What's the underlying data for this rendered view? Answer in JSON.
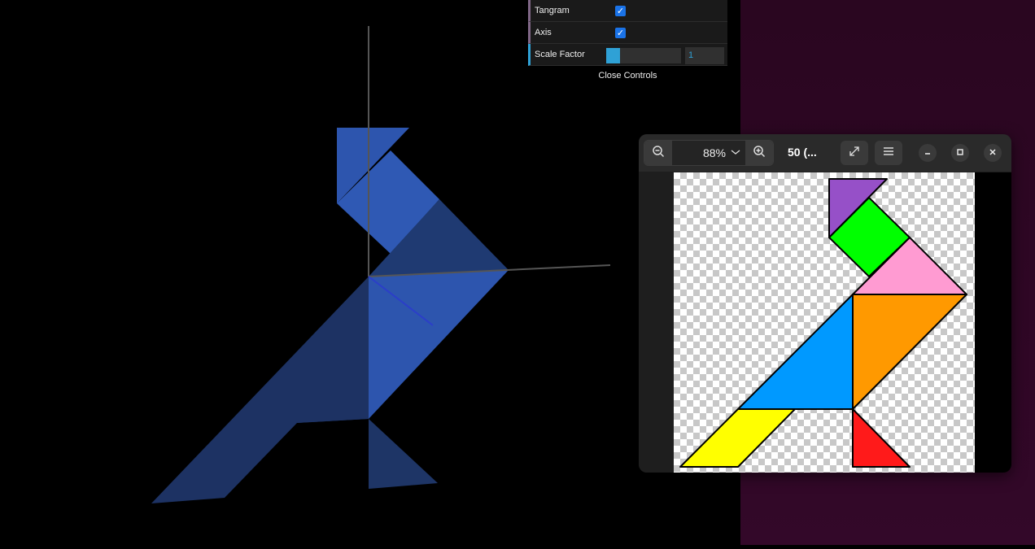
{
  "gui": {
    "rows": [
      {
        "label": "Tangram",
        "type": "boolean",
        "checked": true
      },
      {
        "label": "Axis",
        "type": "boolean",
        "checked": true
      },
      {
        "label": "Scale Factor",
        "type": "number",
        "value": "1",
        "slider_fraction": 0.18
      }
    ],
    "close_label": "Close Controls",
    "colors": {
      "bool_accent": "#806787",
      "number_accent": "#2fa1d6"
    }
  },
  "viewer": {
    "zoom_out_icon": "zoom-out-icon",
    "zoom_value": "88%",
    "zoom_in_icon": "zoom-in-icon",
    "title": "50 (...",
    "fullscreen_icon": "fullscreen-icon",
    "menu_icon": "menu-icon",
    "minimize_icon": "minimize-icon",
    "maximize_icon": "maximize-icon",
    "close_icon": "close-icon"
  },
  "tangram_colors": {
    "purple": "#9650c8",
    "green": "#00ff00",
    "pink": "#ff9bd2",
    "orange": "#ff9900",
    "blue": "#0099ff",
    "yellow": "#ffff00",
    "red": "#ff1a1a"
  },
  "scene_colors": {
    "light_blue": "#2d55ae",
    "dark_blue": "#1e3566",
    "axis_gray": "#555555",
    "axis_blue": "#2b3ec9"
  }
}
